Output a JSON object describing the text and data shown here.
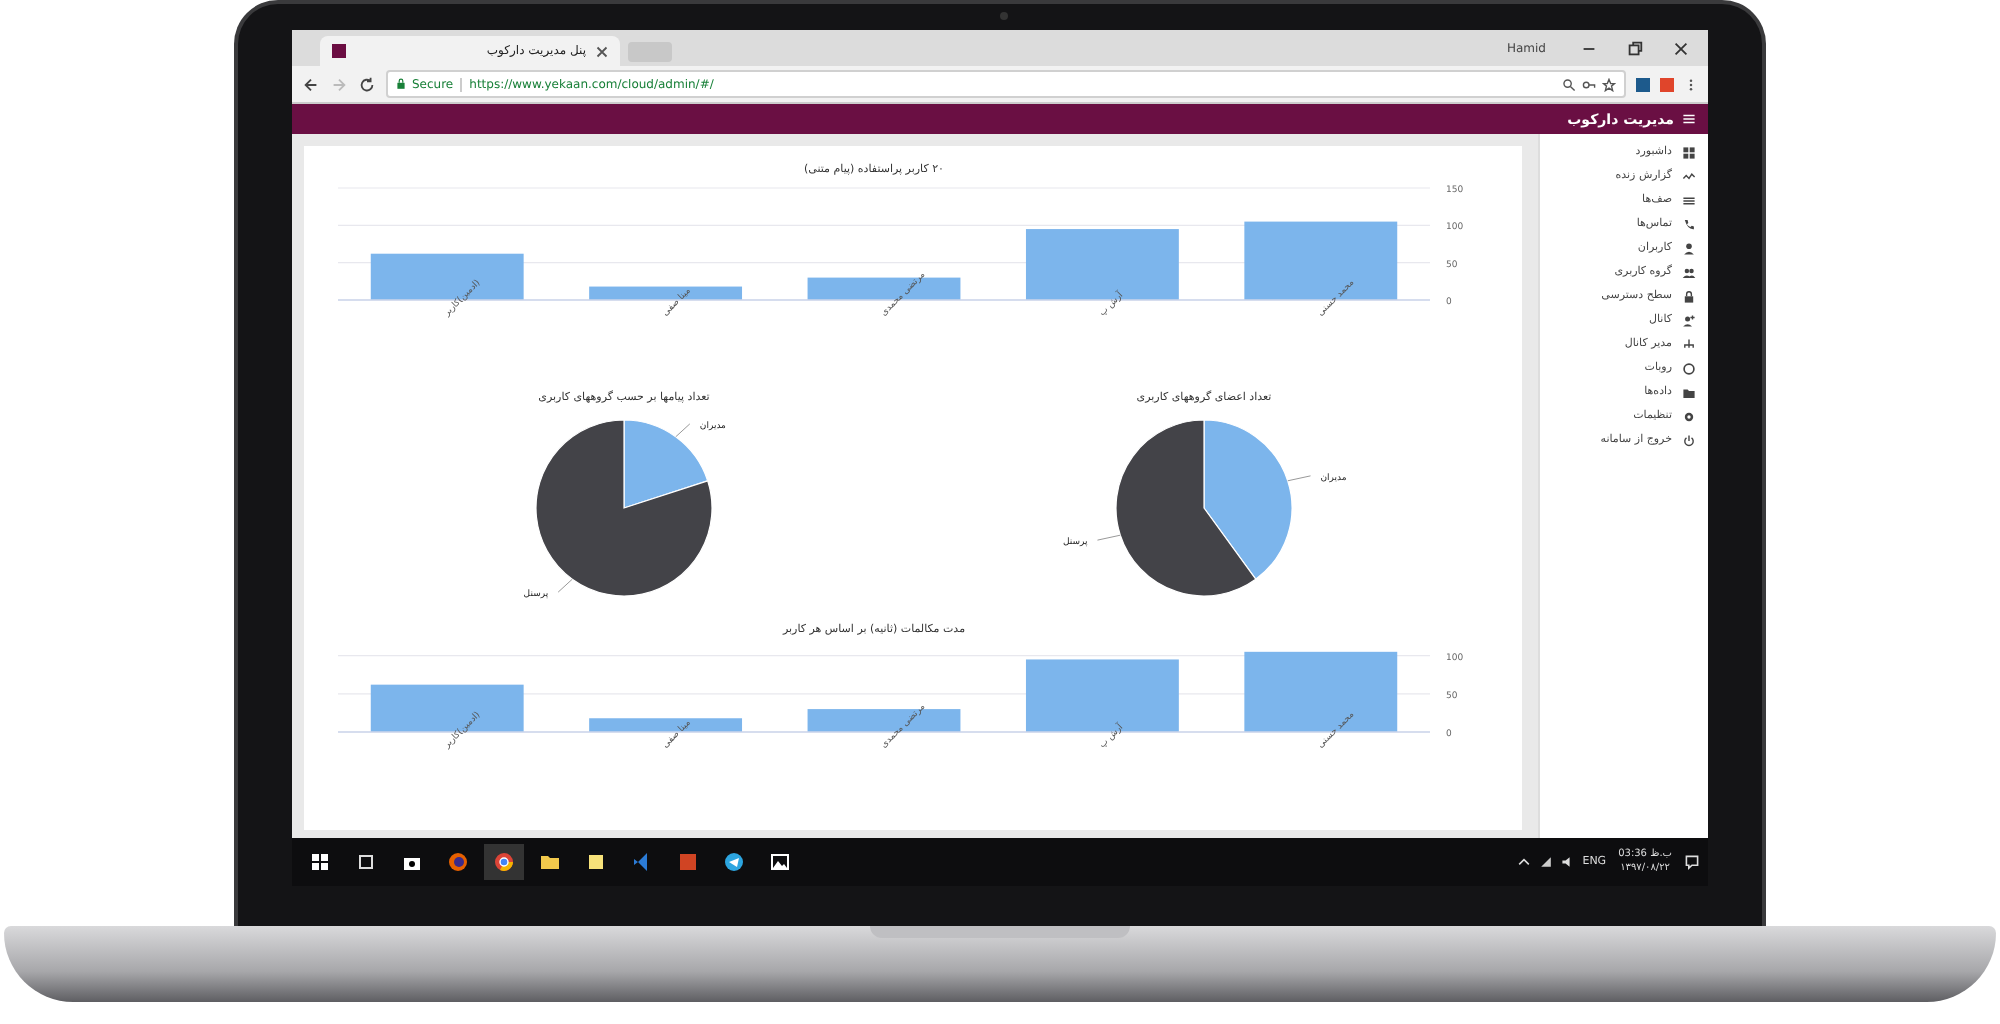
{
  "browser": {
    "tab_title": "پنل مدیریت دارکوب",
    "secure_label": "Secure",
    "url": "https://www.yekaan.com/cloud/admin/#/",
    "user": "Hamid"
  },
  "header": {
    "title": "مدیریت دارکوب"
  },
  "sidebar": {
    "items": [
      {
        "label": "داشبورد"
      },
      {
        "label": "گزارش زنده"
      },
      {
        "label": "صف‌ها"
      },
      {
        "label": "تماس‌ها"
      },
      {
        "label": "کاربران"
      },
      {
        "label": "گروه کاربری"
      },
      {
        "label": "سطح دسترسی"
      },
      {
        "label": "کانال"
      },
      {
        "label": "مدیر کانال"
      },
      {
        "label": "روبات"
      },
      {
        "label": "داده‌ها"
      },
      {
        "label": "تنظیمات"
      },
      {
        "label": "خروج از سامانه"
      }
    ]
  },
  "charts": [
    {
      "chart_data": {
        "type": "bar",
        "title": "۲۰ کاربر پراستفاده (پیام متنی)",
        "categories": [
          "(ادمین)کاربر",
          "مینا صفی",
          "مرتضی محمدی",
          "آرش پ",
          "محمد حسنی"
        ],
        "ylim": [
          0,
          150
        ],
        "yticks": [
          0,
          50,
          100,
          150
        ],
        "series": [
          {
            "color": "#7cb5ec",
            "values": [
              62,
              18,
              30,
              95,
              105
            ]
          }
        ]
      }
    },
    {
      "chart_data": {
        "type": "pie",
        "title": "تعداد اعضای گروههای کاربری",
        "categories": [
          "مدیران",
          "پرسنل"
        ],
        "series": [
          {
            "values": [
              40,
              60
            ]
          }
        ]
      }
    },
    {
      "chart_data": {
        "type": "pie",
        "title": "تعداد پیامها بر حسب گروههای کاربری",
        "categories": [
          "مدیران",
          "پرسنل"
        ],
        "series": [
          {
            "values": [
              20,
              80
            ]
          }
        ]
      }
    },
    {
      "chart_data": {
        "type": "bar",
        "title": "مدت مکالمات (ثانیه) بر اساس هر کاربر",
        "categories": [
          "(ادمین)کاربر",
          "مینا صفی",
          "مرتضی محمدی",
          "آرش پ",
          "محمد حسنی"
        ],
        "ylim": [
          0,
          110
        ],
        "yticks": [
          0,
          50,
          100
        ],
        "series": [
          {
            "color": "#7cb5ec",
            "values": [
              62,
              18,
              30,
              95,
              105
            ]
          }
        ]
      }
    }
  ],
  "taskbar": {
    "language": "ENG",
    "time": "03:36 ب.ظ",
    "date": "۱۳۹۷/۰۸/۲۲"
  }
}
